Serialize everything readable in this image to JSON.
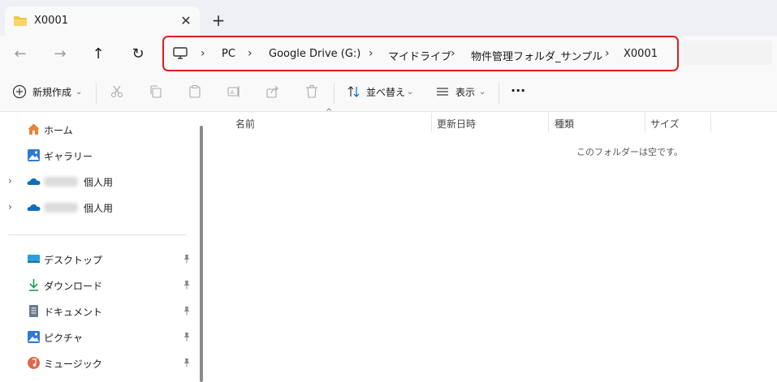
{
  "window": {
    "tab_title": "X0001",
    "tab_close": "✕",
    "new_tab": "+"
  },
  "nav": {
    "back": "←",
    "forward": "→",
    "up": "↑",
    "refresh": "↻"
  },
  "address": {
    "segments": [
      "PC",
      "Google Drive (G:)",
      "マイドライブ",
      "物件管理フォルダ_サンプル",
      "X0001"
    ],
    "separator": "›"
  },
  "toolbar": {
    "new_label": "新規作成",
    "new_dropdown": "⌄",
    "sort_label": "並べ替え",
    "sort_dropdown": "⌄",
    "view_label": "表示",
    "view_dropdown": "⌄",
    "more": "···"
  },
  "sidebar": {
    "items": [
      {
        "label": "ホーム",
        "icon": "home-icon"
      },
      {
        "label": "ギャラリー",
        "icon": "gallery-icon"
      },
      {
        "label": "個人用",
        "icon": "onedrive-icon"
      },
      {
        "label": "個人用",
        "icon": "onedrive-icon"
      },
      {
        "label": "デスクトップ",
        "icon": "desktop-icon"
      },
      {
        "label": "ダウンロード",
        "icon": "download-icon"
      },
      {
        "label": "ドキュメント",
        "icon": "documents-icon"
      },
      {
        "label": "ピクチャ",
        "icon": "pictures-icon"
      },
      {
        "label": "ミュージック",
        "icon": "music-icon"
      }
    ],
    "expander": "›",
    "pin": "📌"
  },
  "content": {
    "columns": [
      "名前",
      "更新日時",
      "種類",
      "サイズ"
    ],
    "sort_caret": "^",
    "empty_message": "このフォルダーは空です。"
  },
  "colors": {
    "accent": "#0067c0",
    "highlight_border": "#e31b1b",
    "folder": "#f4c542"
  }
}
